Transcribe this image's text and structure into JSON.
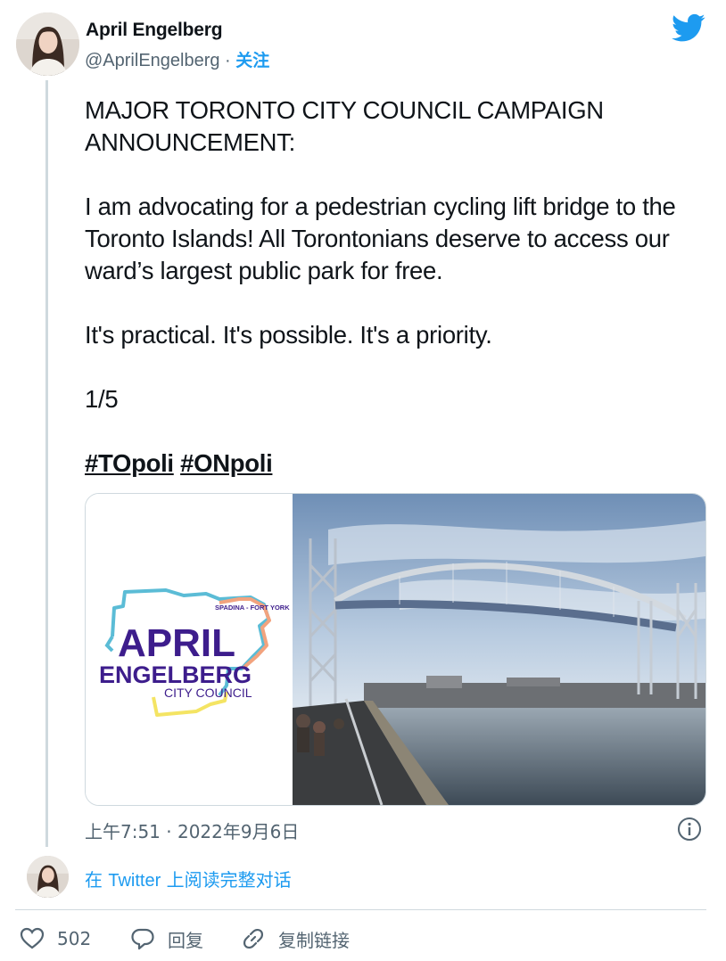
{
  "author": {
    "name": "April Engelberg",
    "handle": "@AprilEngelberg",
    "separator": " · ",
    "follow_label": "关注"
  },
  "tweet": {
    "paragraphs": [
      "MAJOR TORONTO CITY COUNCIL CAMPAIGN ANNOUNCEMENT:",
      "I am advocating for a pedestrian cycling lift bridge to the Toronto Islands! All Torontonians deserve to access our ward’s largest public park for free.",
      "It's practical. It's possible. It's a priority.",
      "1/5"
    ],
    "hashtags": [
      "#TOpoli",
      "#ONpoli"
    ]
  },
  "media": {
    "logo": {
      "top_text": "SPADINA - FORT YORK",
      "line1": "APRIL",
      "line2": "ENGELBERG",
      "line3": "CITY COUNCIL"
    }
  },
  "meta": {
    "timestamp": "上午7:51 · 2022年9月6日"
  },
  "thread": {
    "read_more_prefix": "在 ",
    "read_more_link": "Twitter",
    "read_more_suffix": " 上阅读完整对话"
  },
  "actions": {
    "likes": "502",
    "reply_label": "回复",
    "copy_link_label": "复制链接"
  },
  "colors": {
    "accent": "#1d9bf0",
    "logo_purple": "#3d1d8c",
    "map_teal": "#5bbcd6",
    "map_orange": "#f2a37e",
    "map_yellow": "#f4e463"
  },
  "icons": [
    "twitter-bird-icon",
    "info-icon",
    "heart-icon",
    "reply-icon",
    "link-icon"
  ]
}
